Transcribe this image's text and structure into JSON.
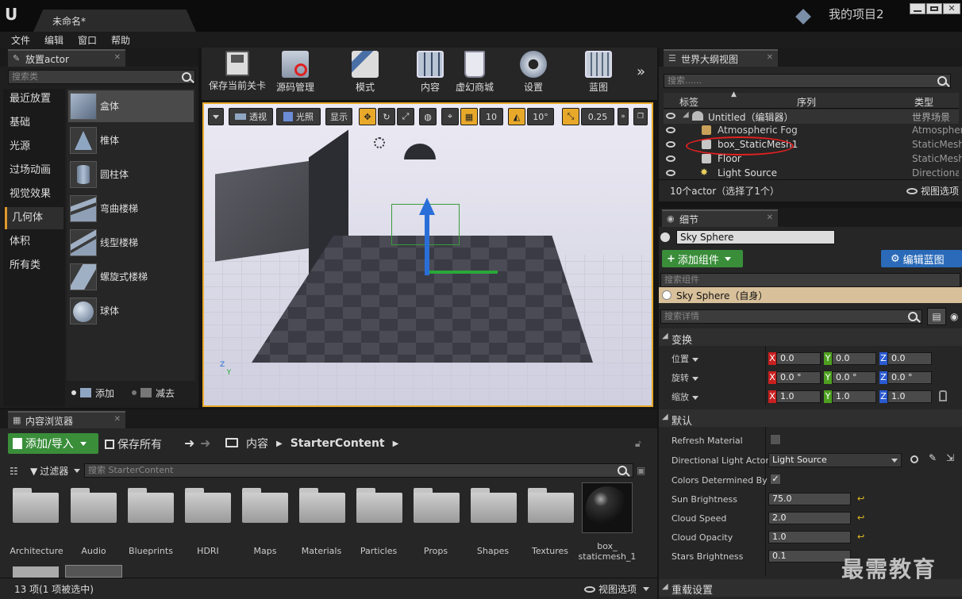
{
  "app": {
    "doc_tab": "未命名*",
    "project": "我的项目2"
  },
  "menu": [
    "文件",
    "编辑",
    "窗口",
    "帮助"
  ],
  "place_panel": {
    "tab": "放置actor",
    "search_placeholder": "搜索类",
    "categories": [
      "最近放置",
      "基础",
      "光源",
      "过场动画",
      "视觉效果",
      "几何体",
      "体积",
      "所有类"
    ],
    "active_category": "几何体",
    "shapes": [
      "盒体",
      "椎体",
      "圆柱体",
      "弯曲楼梯",
      "线型楼梯",
      "螺旋式楼梯",
      "球体"
    ],
    "add_label": "添加",
    "subtract_label": "减去"
  },
  "toolbar": [
    "保存当前关卡",
    "源码管理",
    "模式",
    "内容",
    "虚幻商城",
    "设置",
    "蓝图"
  ],
  "viewport": {
    "perspective": "透视",
    "lit": "光照",
    "show": "显示",
    "grid_snap": "10",
    "rot_snap": "10°",
    "scale_snap": "0.25"
  },
  "outliner": {
    "tab": "世界大纲视图",
    "search_placeholder": "搜索......",
    "col_label": "标签",
    "col_seq": "序列",
    "col_type": "类型",
    "rows": [
      {
        "label": "Untitled（编辑器）",
        "type": "世界场景"
      },
      {
        "label": "Atmospheric Fog",
        "type": "Atmospher"
      },
      {
        "label": "box_StaticMesh1",
        "type": "StaticMesh"
      },
      {
        "label": "Floor",
        "type": "StaticMesh"
      },
      {
        "label": "Light Source",
        "type": "Directional"
      }
    ],
    "status": "10个actor（选择了1个）",
    "view_options": "视图选项"
  },
  "details": {
    "tab": "细节",
    "actor_name": "Sky Sphere",
    "add_component": "添加组件",
    "edit_blueprint": "编辑蓝图",
    "search_components": "搜索组件",
    "component": "Sky Sphere（自身）",
    "search_details": "搜索详情",
    "transform_header": "变换",
    "location": "位置",
    "rotation": "旋转",
    "scale": "缩放",
    "loc": [
      "0.0",
      "0.0",
      "0.0"
    ],
    "rot": [
      "0.0 °",
      "0.0 °",
      "0.0 °"
    ],
    "scl": [
      "1.0",
      "1.0",
      "1.0"
    ],
    "default_header": "默认",
    "props": [
      {
        "label": "Refresh Material",
        "value": ""
      },
      {
        "label": "Directional Light Actor",
        "value": "Light Source"
      },
      {
        "label": "Colors Determined By S",
        "value": ""
      },
      {
        "label": "Sun Brightness",
        "value": "75.0"
      },
      {
        "label": "Cloud Speed",
        "value": "2.0"
      },
      {
        "label": "Cloud Opacity",
        "value": "1.0"
      },
      {
        "label": "Stars Brightness",
        "value": "0.1"
      }
    ],
    "reload_header": "重载设置"
  },
  "content_browser": {
    "tab": "内容浏览器",
    "add_import": "添加/导入",
    "save_all": "保存所有",
    "breadcrumb_root": "内容",
    "breadcrumb_current": "StarterContent",
    "filters": "过滤器",
    "search_placeholder": "搜索 StarterContent",
    "folders": [
      "Architecture",
      "Audio",
      "Blueprints",
      "HDRI",
      "Maps",
      "Materials",
      "Particles",
      "Props",
      "Shapes",
      "Textures"
    ],
    "asset_name": "box_\nstaticmesh_1",
    "status": "13 项(1 项被选中)",
    "view_options": "视图选项"
  },
  "watermark": "最需教育"
}
